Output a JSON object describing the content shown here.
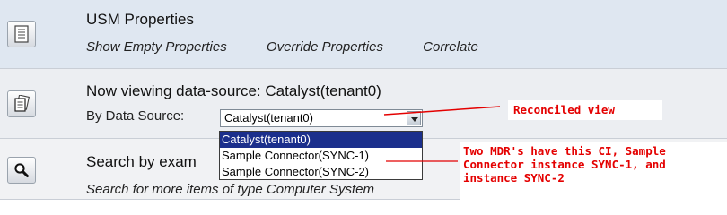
{
  "usm": {
    "title": "USM Properties",
    "links": [
      "Show Empty Properties",
      "Override Properties",
      "Correlate"
    ],
    "icon": "document-icon"
  },
  "viewing": {
    "title": "Now viewing data-source: Catalyst(tenant0)",
    "by_label": "By Data Source:",
    "selected": "Catalyst(tenant0)",
    "options": [
      "Catalyst(tenant0)",
      "Sample Connector(SYNC-1)",
      "Sample Connector(SYNC-2)"
    ],
    "icon": "documents-icon"
  },
  "search": {
    "title": "Search by exam",
    "subtitle": "Search for more items of type Computer System",
    "icon": "magnifier-icon"
  },
  "annotations": {
    "reconciled": "Reconciled view",
    "mdr_line1": "Two MDR's have this CI, Sample",
    "mdr_line2": "Connector instance SYNC-1, and",
    "mdr_line3": "instance SYNC-2",
    "color": "#e40000"
  },
  "colors": {
    "highlight": "#1b2f8c",
    "panel_top": "#dfe7f1"
  }
}
